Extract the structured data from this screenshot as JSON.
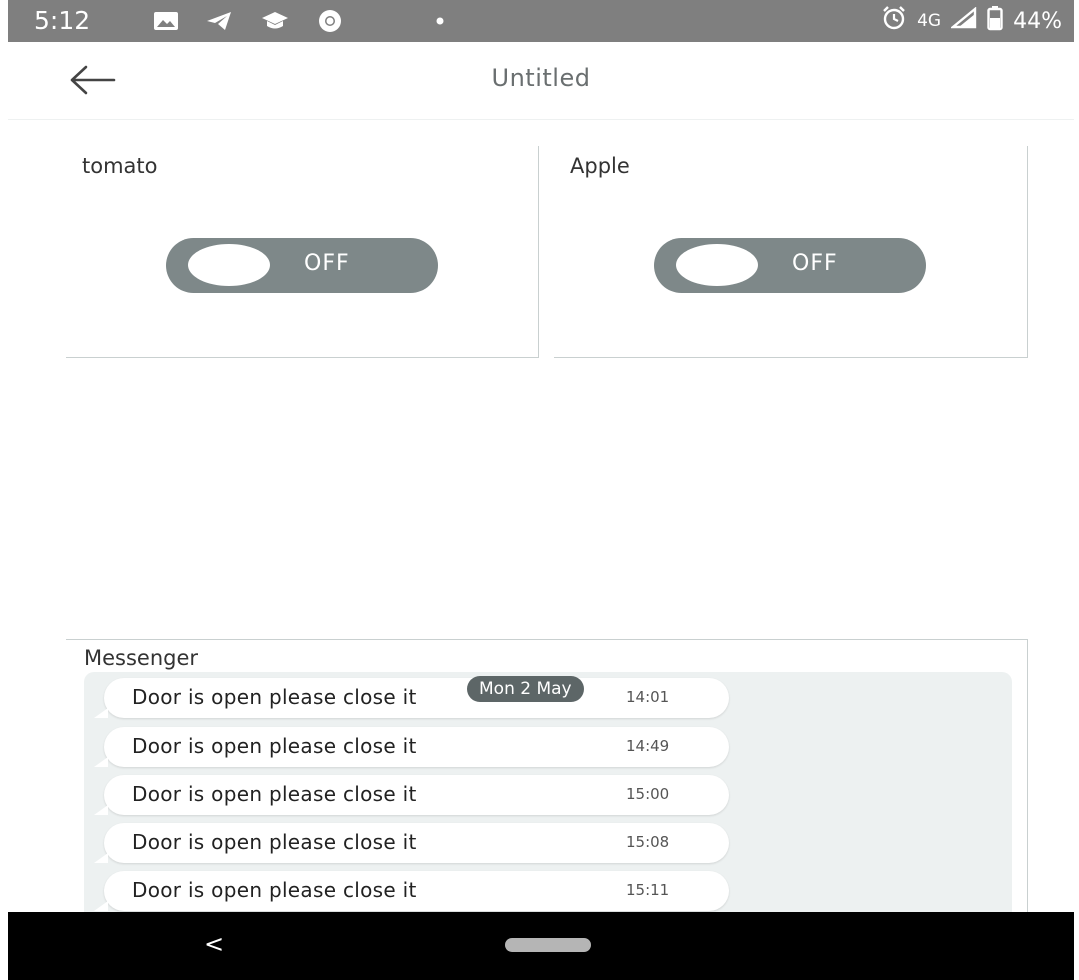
{
  "status_bar": {
    "time": "5:12",
    "notification_icons": [
      "gallery-icon",
      "telegram-icon",
      "education-icon",
      "chrome-icon",
      "dot-icon"
    ],
    "network": "4G",
    "battery": "44%",
    "right_icons": [
      "alarm-icon",
      "signal-icon",
      "battery-icon"
    ]
  },
  "app_bar": {
    "title": "Untitled",
    "back_icon": "arrow-left-icon"
  },
  "switches": [
    {
      "label": "tomato",
      "state": "OFF"
    },
    {
      "label": "Apple",
      "state": "OFF"
    }
  ],
  "messenger": {
    "title": "Messenger",
    "date_badge": "Mon 2 May",
    "messages": [
      {
        "text": "Door is open please close it",
        "time": "14:01"
      },
      {
        "text": "Door is open please close it",
        "time": "14:49"
      },
      {
        "text": "Door is open please close it",
        "time": "15:00"
      },
      {
        "text": "Door is open please close it",
        "time": "15:08"
      },
      {
        "text": "Door is open please close it",
        "time": "15:11"
      }
    ]
  },
  "nav_bar": {
    "back_glyph": "<",
    "home_icon": "home-pill-icon"
  },
  "colors": {
    "status_bar": "#7f7f7f",
    "toggle_off": "#7e8889",
    "message_area": "#edf1f1",
    "date_badge": "#5d6667"
  }
}
